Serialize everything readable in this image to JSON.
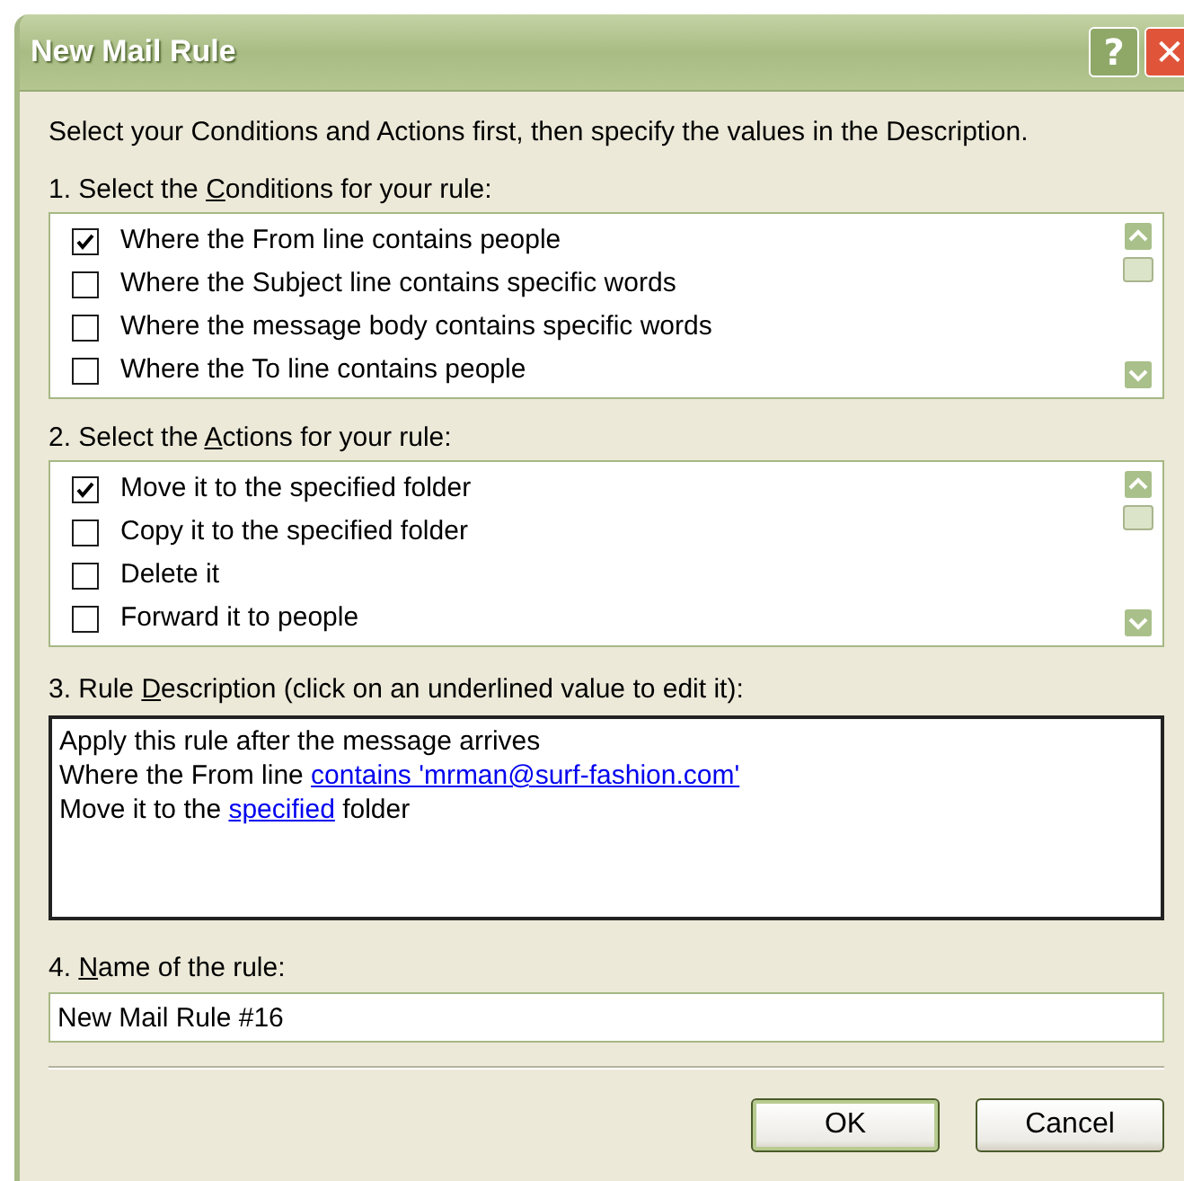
{
  "window": {
    "title": "New Mail Rule",
    "title_buttons": [
      "?",
      "✕"
    ]
  },
  "intro": "Select your Conditions and Actions first, then specify the values in the Description.",
  "conditions": {
    "label": {
      "before": "1. Select the ",
      "key": "C",
      "after": "onditions for your rule:"
    },
    "items": [
      {
        "text": "Where the From line contains people",
        "checked": true
      },
      {
        "text": "Where the Subject line contains specific words",
        "checked": false
      },
      {
        "text": "Where the message body contains specific words",
        "checked": false
      },
      {
        "text": "Where the To line contains people",
        "checked": false
      }
    ]
  },
  "actions": {
    "label": {
      "before": "2. Select the ",
      "key": "A",
      "after": "ctions for your rule:"
    },
    "items": [
      {
        "text": "Move it to the specified folder",
        "checked": true
      },
      {
        "text": "Copy it to the specified folder",
        "checked": false
      },
      {
        "text": "Delete it",
        "checked": false
      },
      {
        "text": "Forward it to people",
        "checked": false
      }
    ]
  },
  "description": {
    "label": {
      "before": "3. Rule ",
      "key": "D",
      "after": "escription (click on an underlined value to edit it):"
    },
    "lines": [
      [
        {
          "kind": "text",
          "text": "Apply this rule after the message arrives"
        }
      ],
      [
        {
          "kind": "text",
          "text": "Where the From line "
        },
        {
          "kind": "link",
          "text": "contains 'mrman@surf-fashion.com'"
        }
      ],
      [
        {
          "kind": "text",
          "text": "Move it to the "
        },
        {
          "kind": "link",
          "text": "specified"
        },
        {
          "kind": "text",
          "text": " folder"
        }
      ]
    ]
  },
  "name": {
    "label": {
      "before": "4. ",
      "key": "N",
      "after": "ame of the rule:"
    },
    "value": "New Mail Rule #16"
  },
  "buttons": [
    {
      "label": "OK",
      "default": true
    },
    {
      "label": "Cancel",
      "default": false
    }
  ]
}
